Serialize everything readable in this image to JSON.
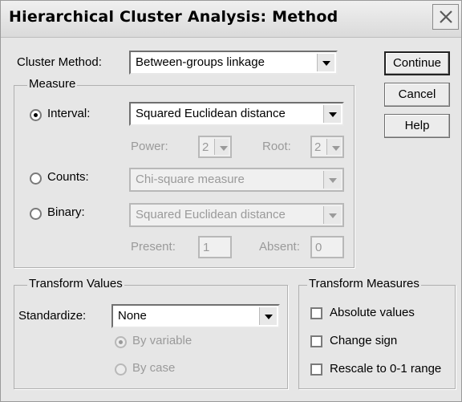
{
  "window": {
    "title": "Hierarchical Cluster Analysis: Method"
  },
  "cluster_method": {
    "label": "Cluster Method:",
    "value": "Between-groups linkage"
  },
  "buttons": {
    "continue": "Continue",
    "cancel": "Cancel",
    "help": "Help"
  },
  "measure": {
    "legend": "Measure",
    "interval": {
      "label": "Interval:",
      "value": "Squared Euclidean distance",
      "selected": true
    },
    "power": {
      "label": "Power:",
      "value": "2"
    },
    "root": {
      "label": "Root:",
      "value": "2"
    },
    "counts": {
      "label": "Counts:",
      "value": "Chi-square measure",
      "selected": false
    },
    "binary": {
      "label": "Binary:",
      "value": "Squared Euclidean distance",
      "selected": false
    },
    "present": {
      "label": "Present:",
      "value": "1"
    },
    "absent": {
      "label": "Absent:",
      "value": "0"
    }
  },
  "transform_values": {
    "legend": "Transform Values",
    "standardize": {
      "label": "Standardize:",
      "value": "None"
    },
    "by_variable": "By variable",
    "by_case": "By case"
  },
  "transform_measures": {
    "legend": "Transform Measures",
    "absolute_values": "Absolute values",
    "change_sign": "Change sign",
    "rescale": "Rescale to 0-1 range"
  }
}
